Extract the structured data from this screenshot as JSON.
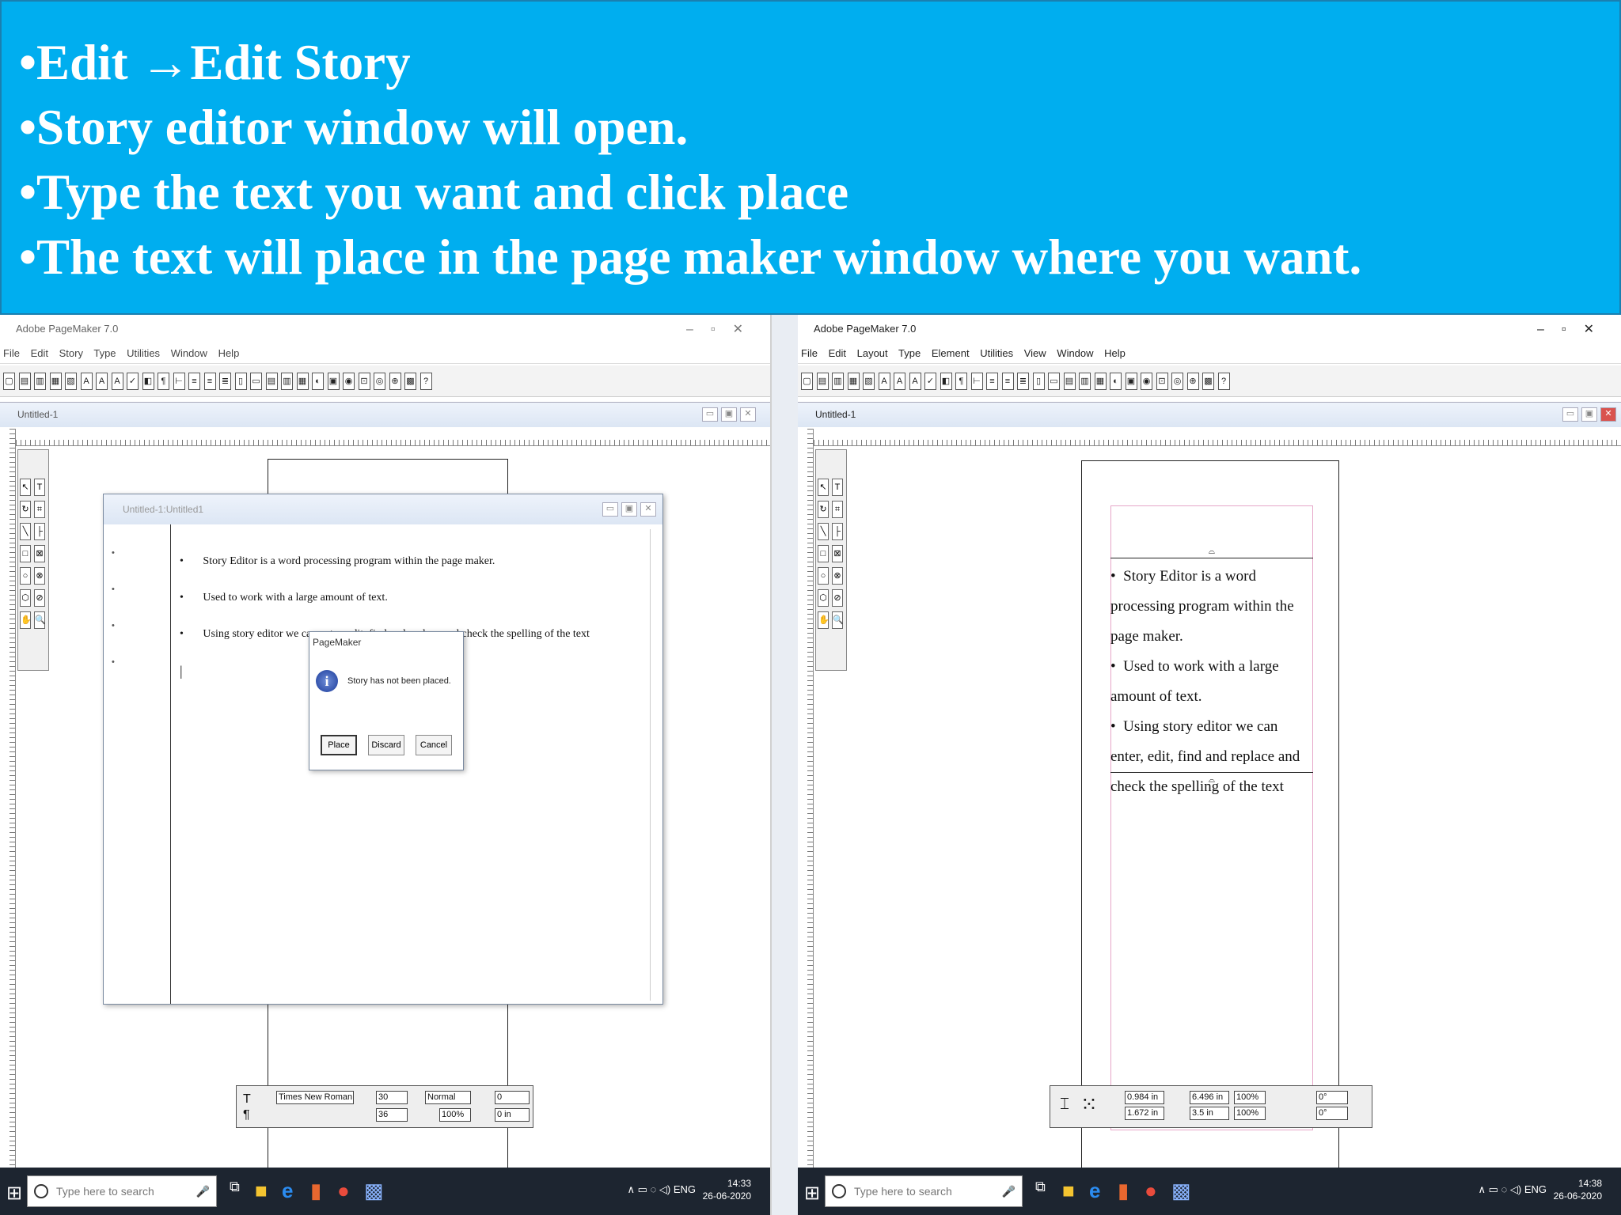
{
  "slide": {
    "bullets": [
      "•Edit →Edit Story",
      "•Story editor window will open.",
      "•Type the text you want and click place",
      "•The text will place in the page maker window where you want."
    ]
  },
  "left": {
    "title": "Adobe PageMaker 7.0",
    "menu": [
      "File",
      "Edit",
      "Story",
      "Type",
      "Utilities",
      "Window",
      "Help"
    ],
    "doc_title": "Untitled-1",
    "story_title": "Untitled-1:Untitled1",
    "story_lines": [
      "Story Editor is a word processing program within the page maker.",
      "Used to work with a large amount of text.",
      "Using story editor we can enter, edit, find and replace and check the spelling of the text"
    ],
    "dialog": {
      "title": "PageMaker",
      "message": "Story has not been placed.",
      "buttons": [
        "Place",
        "Discard",
        "Cancel"
      ]
    },
    "control": {
      "font": "Times New Roman",
      "size": "30",
      "leading": "36",
      "style": "Normal",
      "width": "100%",
      "kern": "0",
      "track": "0 in"
    }
  },
  "right": {
    "title": "Adobe PageMaker 7.0",
    "menu": [
      "File",
      "Edit",
      "Layout",
      "Type",
      "Element",
      "Utilities",
      "View",
      "Window",
      "Help"
    ],
    "doc_title": "Untitled-1",
    "placed_text": [
      "Story Editor is a word processing program within the page maker.",
      "Used to work with a large amount of text.",
      "Using story editor we can enter, edit, find and replace and check the spelling of the text"
    ],
    "control": {
      "x": "0.984 in",
      "y": "1.672 in",
      "w": "6.496 in",
      "h": "3.5 in",
      "sx": "100%",
      "sy": "100%",
      "rot": "0°",
      "skew": "0°"
    }
  },
  "taskbar": {
    "search_placeholder": "Type here to search",
    "lang": "ENG",
    "left_time": "14:33",
    "left_date": "26-06-2020",
    "right_time": "14:38",
    "right_date": "26-06-2020"
  },
  "colors": {
    "banner": "#00aeef",
    "taskbar": "#1d2530"
  }
}
